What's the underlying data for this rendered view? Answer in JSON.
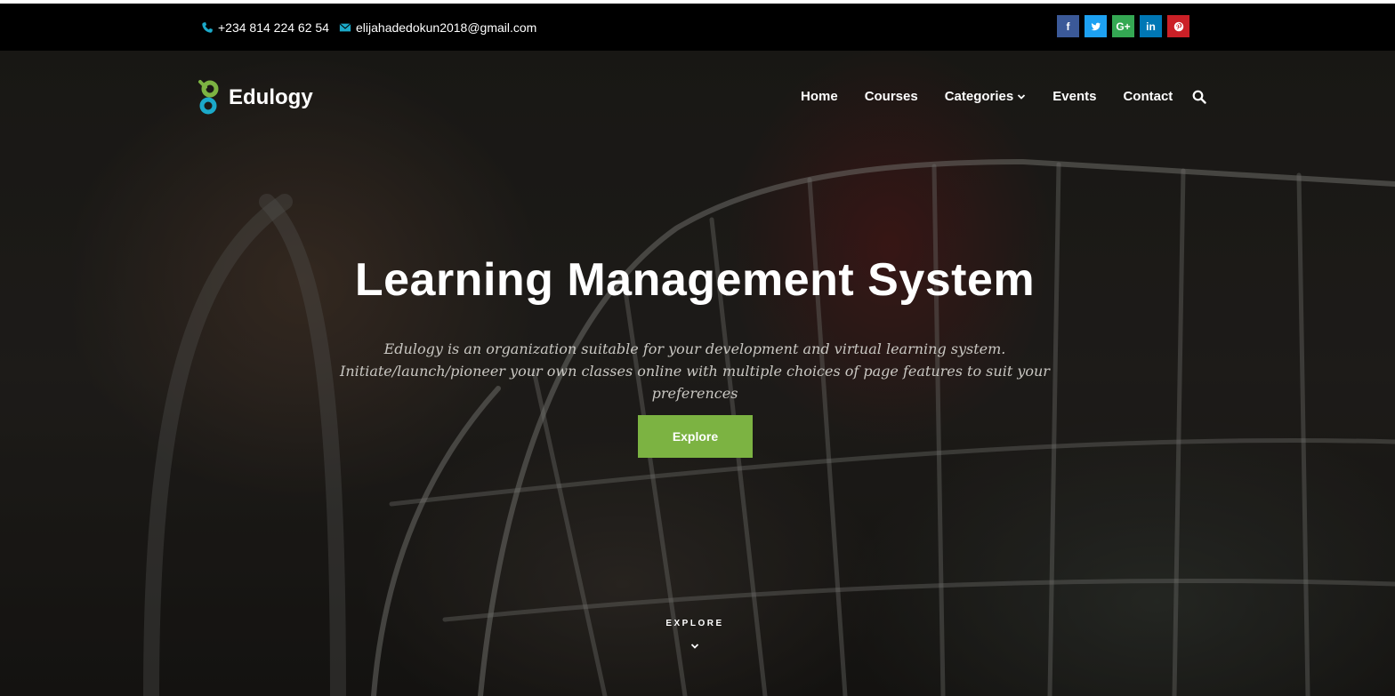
{
  "topbar": {
    "phone": "+234 814 224 62 54",
    "email": "elijahadedokun2018@gmail.com",
    "socials": [
      {
        "name": "facebook",
        "glyph": "f",
        "color": "#3b5998"
      },
      {
        "name": "twitter",
        "glyph": "t",
        "color": "#1da1f2"
      },
      {
        "name": "google-plus",
        "glyph": "G+",
        "color": "#34a853"
      },
      {
        "name": "linkedin",
        "glyph": "in",
        "color": "#0077b5"
      },
      {
        "name": "pinterest",
        "glyph": "p",
        "color": "#cb2027"
      }
    ]
  },
  "brand": {
    "name": "Edulogy",
    "logo_colors": {
      "top": "#7cb342",
      "bottom": "#1ba9c9"
    }
  },
  "nav": {
    "items": [
      "Home",
      "Courses",
      "Categories",
      "Events",
      "Contact"
    ]
  },
  "hero": {
    "title": "Learning Management System",
    "description": "Edulogy is an organization suitable for your development and virtual learning system. Initiate/launch/pioneer your own classes online with multiple choices of page features to suit your preferences",
    "button": "Explore",
    "scroll_label": "EXPLORE"
  },
  "colors": {
    "accent": "#7cb342",
    "icon_accent": "#1ba9c9"
  }
}
